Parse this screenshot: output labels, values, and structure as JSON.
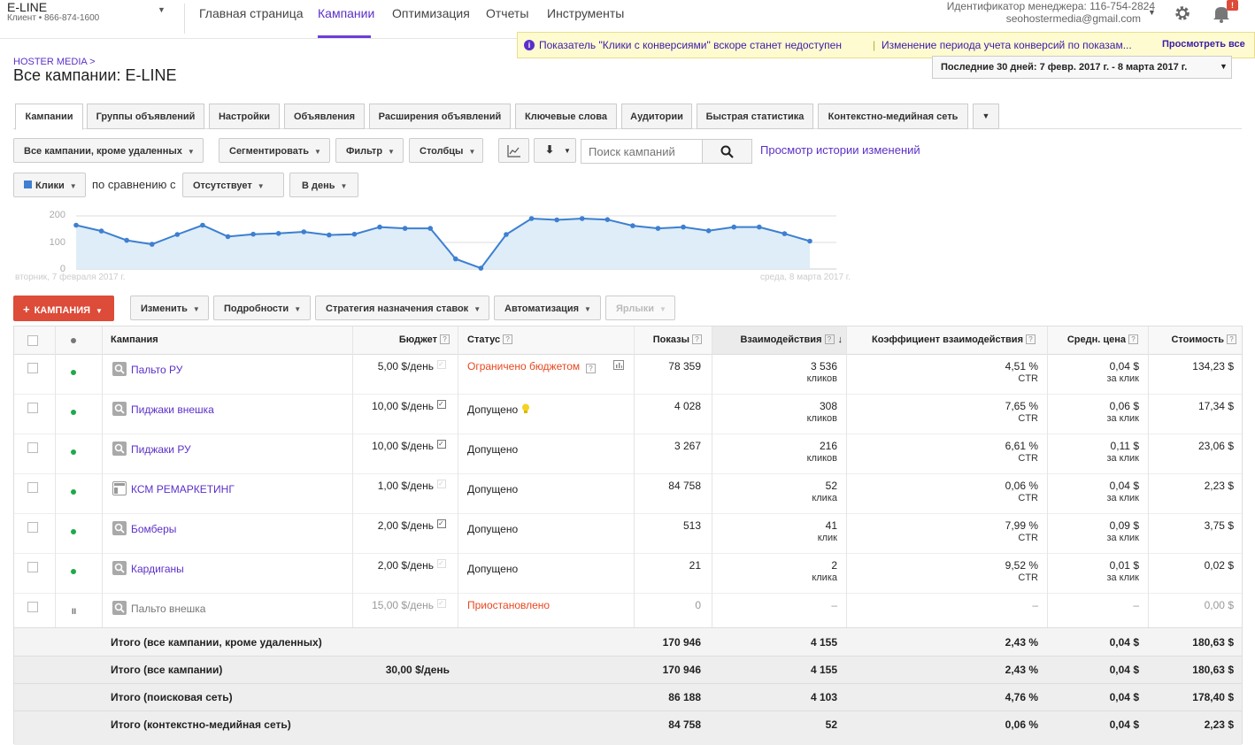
{
  "account": {
    "name": "E-LINE",
    "subtitle": "Клиент  •  866-874-1600"
  },
  "nav": {
    "items": [
      "Главная страница",
      "Кампании",
      "Оптимизация",
      "Отчеты",
      "Инструменты"
    ],
    "active": "Кампании"
  },
  "manager": {
    "id_line": "Идентификатор менеджера: 116-754-2824",
    "email": "seohostermedia@gmail.com"
  },
  "notification": {
    "text1": "Показатель \"Клики с конверсиями\" вскоре станет недоступен",
    "text2": "Изменение периода учета конверсий по показам...",
    "view_all": "Просмотреть все"
  },
  "breadcrumb": "HOSTER MEDIA >",
  "page_title": "Все кампании: E-LINE",
  "date_range": "Последние 30 дней: 7 февр. 2017 г. - 8 марта 2017 г.",
  "tabs": [
    "Кампании",
    "Группы объявлений",
    "Настройки",
    "Объявления",
    "Расширения объявлений",
    "Ключевые слова",
    "Аудитории",
    "Быстрая статистика",
    "Контекстно-медийная сеть"
  ],
  "toolbar": {
    "filter_campaigns": "Все кампании, кроме удаленных",
    "segment": "Сегментировать",
    "filter": "Фильтр",
    "columns": "Столбцы",
    "search_placeholder": "Поиск кампаний",
    "history_link": "Просмотр истории изменений"
  },
  "chart_controls": {
    "metric": "Клики",
    "compare_label": "по сравнению с",
    "compare_value": "Отсутствует",
    "period": "В день"
  },
  "chart_data": {
    "type": "area",
    "y_ticks": [
      "200",
      "100",
      "0"
    ],
    "ylim": [
      0,
      200
    ],
    "x_start_label": "вторник, 7 февраля 2017 г.",
    "x_end_label": "среда, 8 марта 2017 г.",
    "values": [
      165,
      143,
      108,
      93,
      130,
      165,
      122,
      131,
      134,
      140,
      128,
      131,
      158,
      153,
      153,
      38,
      3,
      130,
      190,
      185,
      190,
      186,
      163,
      153,
      158,
      144,
      158,
      158,
      133,
      105
    ],
    "color": "#3d7fd1",
    "fill": "#deedf7"
  },
  "actions": {
    "new_campaign": "КАМПАНИЯ",
    "edit": "Изменить",
    "details": "Подробности",
    "bid_strategy": "Стратегия назначения ставок",
    "automation": "Автоматизация",
    "labels": "Ярлыки"
  },
  "columns": {
    "campaign": "Кампания",
    "budget": "Бюджет",
    "status": "Статус",
    "impressions": "Показы",
    "interactions": "Взаимодействия",
    "interaction_rate": "Коэффициент взаимодействия",
    "avg_cost": "Средн. цена",
    "cost": "Стоимость"
  },
  "rows": [
    {
      "name": "Пальто РУ",
      "budget": "5,00 $/день",
      "status": "Ограничено бюджетом",
      "impressions": "78 359",
      "interactions": "3 536",
      "interactions_unit": "кликов",
      "rate": "4,51 %",
      "rate_unit": "CTR",
      "avg": "0,04 $",
      "avg_unit": "за клик",
      "cost": "134,23 $"
    },
    {
      "name": "Пиджаки внешка",
      "budget": "10,00 $/день",
      "status": "Допущено",
      "impressions": "4 028",
      "interactions": "308",
      "interactions_unit": "кликов",
      "rate": "7,65 %",
      "rate_unit": "CTR",
      "avg": "0,06 $",
      "avg_unit": "за клик",
      "cost": "17,34 $"
    },
    {
      "name": "Пиджаки РУ",
      "budget": "10,00 $/день",
      "status": "Допущено",
      "impressions": "3 267",
      "interactions": "216",
      "interactions_unit": "кликов",
      "rate": "6,61 %",
      "rate_unit": "CTR",
      "avg": "0,11 $",
      "avg_unit": "за клик",
      "cost": "23,06 $"
    },
    {
      "name": "КСМ РЕМАРКЕТИНГ",
      "budget": "1,00 $/день",
      "status": "Допущено",
      "impressions": "84 758",
      "interactions": "52",
      "interactions_unit": "клика",
      "rate": "0,06 %",
      "rate_unit": "CTR",
      "avg": "0,04 $",
      "avg_unit": "за клик",
      "cost": "2,23 $"
    },
    {
      "name": "Бомберы",
      "budget": "2,00 $/день",
      "status": "Допущено",
      "impressions": "513",
      "interactions": "41",
      "interactions_unit": "клик",
      "rate": "7,99 %",
      "rate_unit": "CTR",
      "avg": "0,09 $",
      "avg_unit": "за клик",
      "cost": "3,75 $"
    },
    {
      "name": "Кардиганы",
      "budget": "2,00 $/день",
      "status": "Допущено",
      "impressions": "21",
      "interactions": "2",
      "interactions_unit": "клика",
      "rate": "9,52 %",
      "rate_unit": "CTR",
      "avg": "0,01 $",
      "avg_unit": "за клик",
      "cost": "0,02 $"
    },
    {
      "name": "Пальто внешка",
      "budget": "15,00 $/день",
      "status": "Приостановлено",
      "impressions": "0",
      "interactions": "–",
      "interactions_unit": "",
      "rate": "–",
      "rate_unit": "",
      "avg": "–",
      "avg_unit": "",
      "cost": "0,00 $"
    }
  ],
  "totals": [
    {
      "label": "Итого (все кампании, кроме удаленных)",
      "budget": "",
      "impressions": "170 946",
      "interactions": "4 155",
      "rate": "2,43 %",
      "avg": "0,04 $",
      "cost": "180,63 $"
    },
    {
      "label": "Итого (все кампании)",
      "budget": "30,00 $/день",
      "impressions": "170 946",
      "interactions": "4 155",
      "rate": "2,43 %",
      "avg": "0,04 $",
      "cost": "180,63 $"
    },
    {
      "label": "Итого (поисковая сеть)",
      "budget": "",
      "impressions": "86 188",
      "interactions": "4 103",
      "rate": "4,76 %",
      "avg": "0,04 $",
      "cost": "178,40 $"
    },
    {
      "label": "Итого (контекстно-медийная сеть)",
      "budget": "",
      "impressions": "84 758",
      "interactions": "52",
      "rate": "0,06 %",
      "avg": "0,04 $",
      "cost": "2,23 $"
    }
  ]
}
